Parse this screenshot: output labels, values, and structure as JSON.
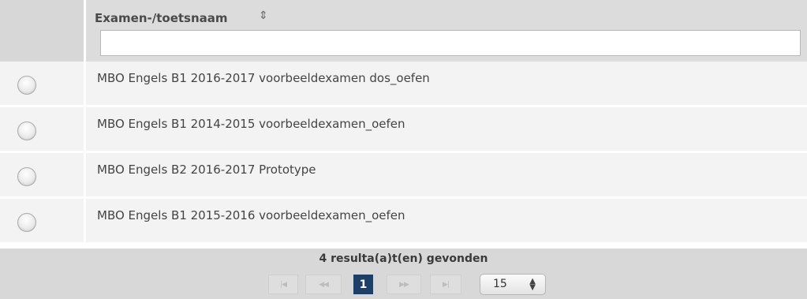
{
  "header": {
    "column_title": "Examen-/toetsnaam",
    "sort_icon": "sort-updown-icon",
    "filter_value": "",
    "filter_placeholder": ""
  },
  "rows": [
    {
      "label": "MBO Engels B1 2016-2017 voorbeeldexamen dos_oefen",
      "selected": false
    },
    {
      "label": "MBO Engels B1 2014-2015 voorbeeldexamen_oefen",
      "selected": false
    },
    {
      "label": "MBO Engels B2 2016-2017 Prototype",
      "selected": false
    },
    {
      "label": "MBO Engels B1 2015-2016 voorbeeldexamen_oefen",
      "selected": false
    }
  ],
  "footer": {
    "result_text": "4 resulta(a)t(en) gevonden",
    "pager": {
      "first_icon": "first-page-icon",
      "prev_icon": "previous-page-icon",
      "current_page": "1",
      "next_icon": "next-page-icon",
      "last_icon": "last-page-icon"
    },
    "page_size": "15"
  },
  "colors": {
    "header_bg": "#dcdcdc",
    "row_bg": "#f3f3f3",
    "footer_bg": "#d8d8d8",
    "current_page_bg": "#1e3f66"
  }
}
